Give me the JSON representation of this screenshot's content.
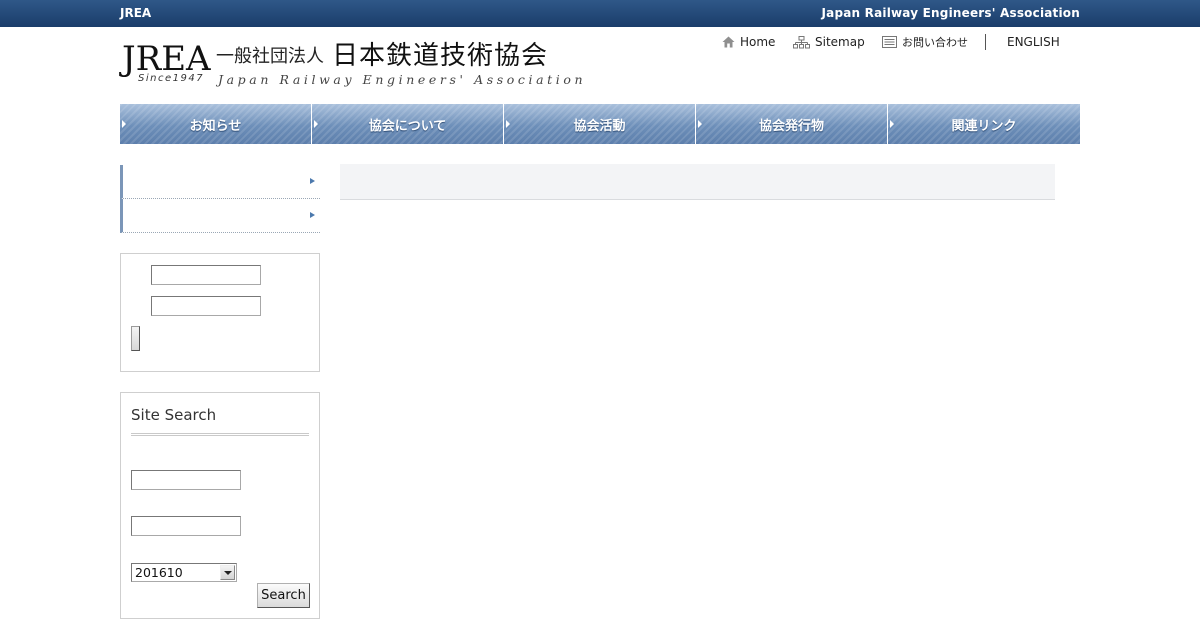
{
  "topbar": {
    "left_text": "JREA",
    "right_text": "Japan Railway Engineers' Association"
  },
  "logo": {
    "mark": "JREA",
    "since": "Since1947",
    "prefix": "一般社団法人",
    "name_ja": "日本鉄道技術協会",
    "name_en": "Japan Railway Engineers' Association"
  },
  "utility_nav": {
    "home": "Home",
    "sitemap": "Sitemap",
    "contact": "お問い合わせ",
    "english": "ENGLISH"
  },
  "icons": {
    "home": "home-icon",
    "sitemap": "sitemap-icon",
    "contact": "document-list-icon"
  },
  "global_nav": [
    {
      "label": "お知らせ"
    },
    {
      "label": "協会について"
    },
    {
      "label": "協会活動"
    },
    {
      "label": "協会発行物"
    },
    {
      "label": "関連リンク"
    }
  ],
  "site_search": {
    "title": "Site Search",
    "year_month_value": "201610",
    "button_label": "Search"
  },
  "colors": {
    "topbar": "#1f4573",
    "nav": "#6d8fb9",
    "accent": "#4c79ad"
  }
}
